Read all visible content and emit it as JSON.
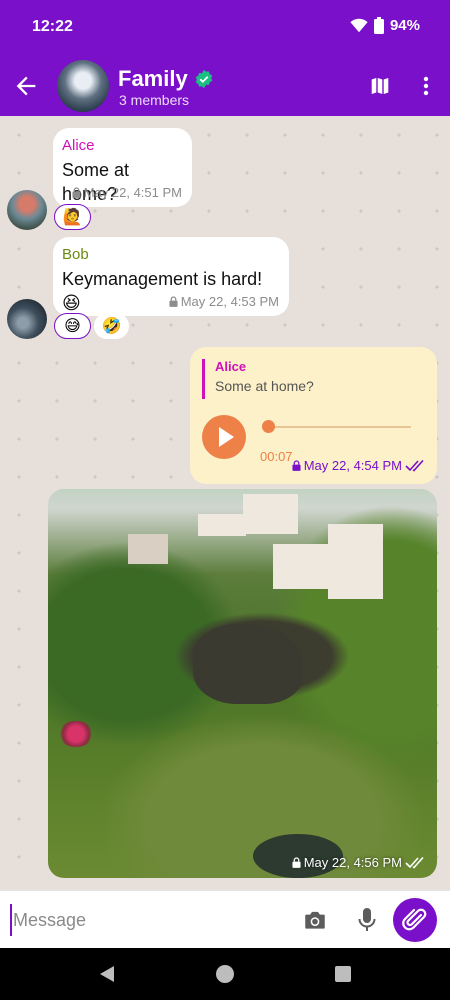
{
  "status_bar": {
    "time": "12:22",
    "battery": "94%",
    "icons": [
      "wifi-icon",
      "battery-icon"
    ]
  },
  "header": {
    "title": "Family",
    "subtitle": "3 members",
    "verified": true,
    "icons": [
      "back-arrow-icon",
      "map-icon",
      "more-vert-icon"
    ]
  },
  "messages": [
    {
      "sender": "Alice",
      "text": "Some at home?",
      "time": "May 22, 4:51 PM",
      "reactions": [
        "🙋"
      ]
    },
    {
      "sender": "Bob",
      "text": "Keymanagement is hard! 😆",
      "time": "May 22, 4:53 PM",
      "reactions": [
        "😅",
        "🤣"
      ]
    },
    {
      "quote_sender": "Alice",
      "quote_text": "Some at home?",
      "audio_duration": "00:07",
      "time": "May 22, 4:54 PM",
      "outgoing": true,
      "read": true
    },
    {
      "type": "image",
      "time": "May 22, 4:56 PM",
      "outgoing": true,
      "read": true
    }
  ],
  "composer": {
    "placeholder": "Message",
    "icons": [
      "camera-icon",
      "mic-icon",
      "attach-icon"
    ]
  },
  "colors": {
    "primary": "#7a10c9",
    "alice": "#d010b9",
    "bob": "#6b8a10",
    "audio_accent": "#ee8148",
    "outgoing_bubble": "#fcf1c9",
    "chat_background": "#e6dfda"
  }
}
